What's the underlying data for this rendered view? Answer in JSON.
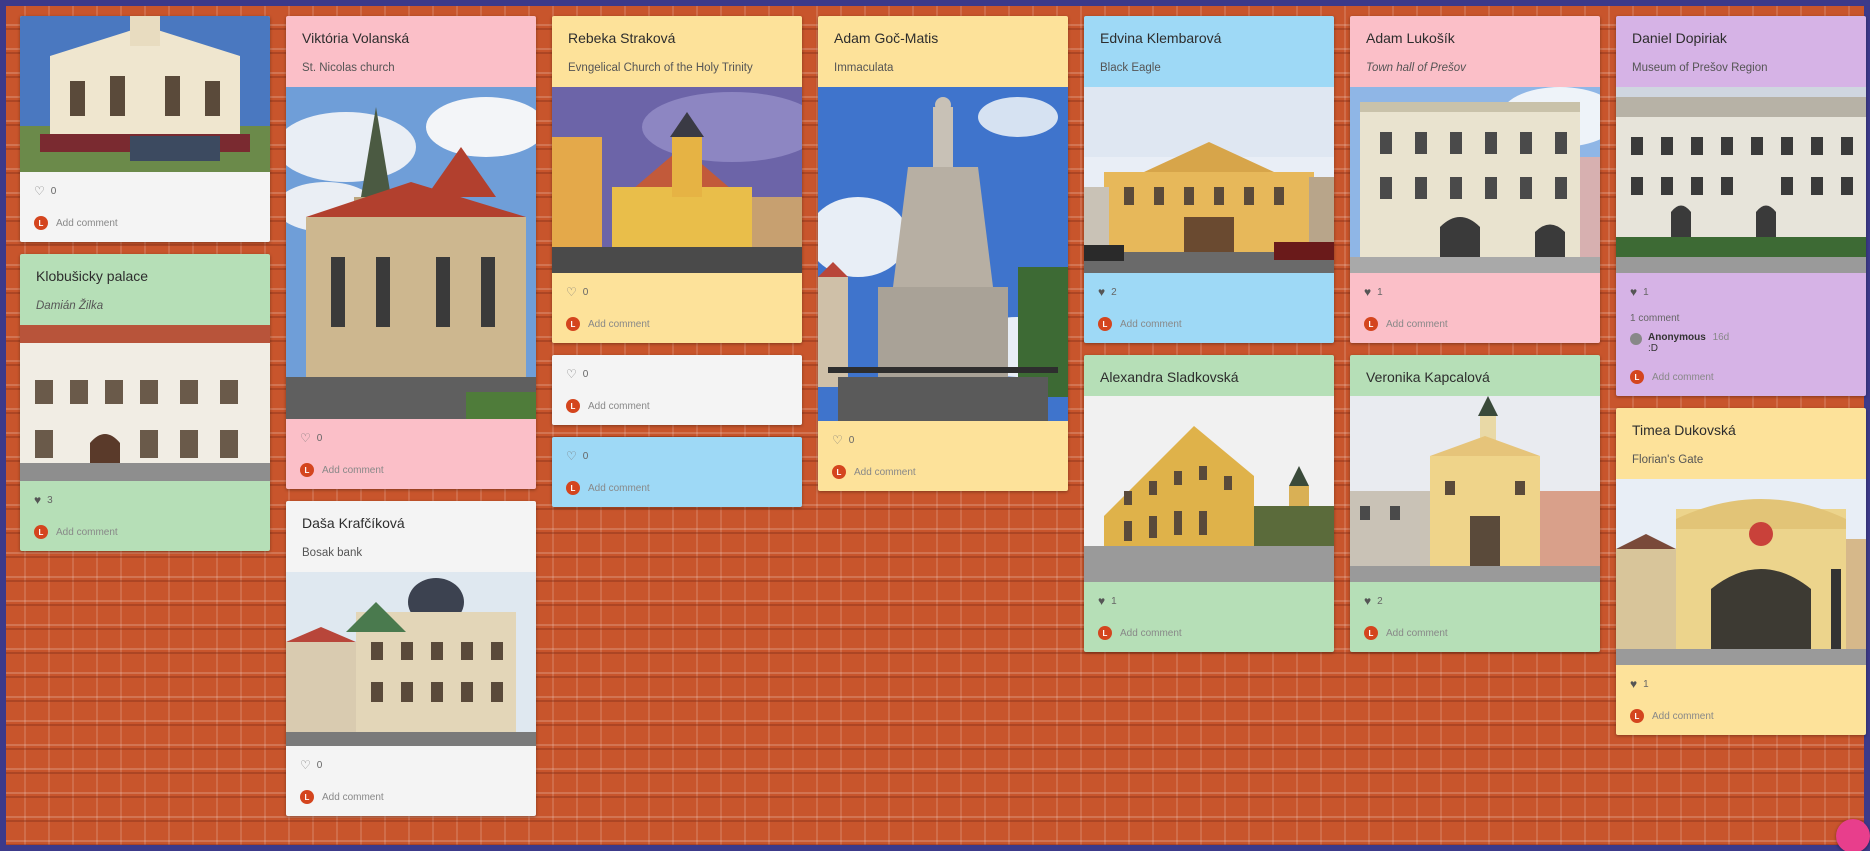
{
  "board": {
    "background": "#c8552c",
    "accent": "#d4451e",
    "add_comment_label": "Add comment",
    "avatar_letter": "L"
  },
  "cards": [
    {
      "id": "c1",
      "author": "",
      "subtitle": "",
      "likes": "0",
      "liked": false,
      "color": "#f4f4f4"
    },
    {
      "id": "c2",
      "author": "Klobušicky palace",
      "subtitle": "Damián Žilka",
      "likes": "3",
      "liked": true,
      "color": "#b6dfb7"
    },
    {
      "id": "c3",
      "author": "Viktória Volanská",
      "subtitle": "St. Nicolas church",
      "likes": "0",
      "liked": false,
      "color": "#fbbfc8"
    },
    {
      "id": "c4",
      "author": "Daša Krafčíková",
      "subtitle": "Bosak bank",
      "likes": "0",
      "liked": false,
      "color": "#f4f4f4"
    },
    {
      "id": "c5",
      "author": "Rebeka Straková",
      "subtitle": "Evngelical Church of the Holy Trinity",
      "likes": "0",
      "liked": false,
      "color": "#fde29a"
    },
    {
      "id": "c6",
      "author": "",
      "subtitle": "",
      "likes": "0",
      "liked": false,
      "color": "#f4f4f4"
    },
    {
      "id": "c7",
      "author": "",
      "subtitle": "",
      "likes": "0",
      "liked": false,
      "color": "#9ed9f6"
    },
    {
      "id": "c8",
      "author": "Adam Goč-Matis",
      "subtitle": "Immaculata",
      "likes": "0",
      "liked": false,
      "color": "#fde29a"
    },
    {
      "id": "c9",
      "author": "Edvina Klembarová",
      "subtitle": "Black Eagle",
      "likes": "2",
      "liked": true,
      "color": "#9ed9f6"
    },
    {
      "id": "c10",
      "author": "Alexandra Sladkovská",
      "subtitle": "",
      "likes": "1",
      "liked": true,
      "color": "#b6dfb7"
    },
    {
      "id": "c11",
      "author": "Adam Lukošík",
      "subtitle": "Town hall of Prešov",
      "likes": "1",
      "liked": true,
      "color": "#fbbfc8"
    },
    {
      "id": "c12",
      "author": "Veronika Kapcalová",
      "subtitle": "",
      "likes": "2",
      "liked": true,
      "color": "#b6dfb7"
    },
    {
      "id": "c13",
      "author": "Daniel Dopiriak",
      "subtitle": "Museum of Prešov Region",
      "likes": "1",
      "liked": true,
      "color": "#d6b3e6",
      "comment_count": "1 comment",
      "comment": {
        "name": "Anonymous",
        "time": "16d",
        "text": ":D"
      }
    },
    {
      "id": "c14",
      "author": "Timea Dukovská",
      "subtitle": "Florian's Gate",
      "likes": "1",
      "liked": true,
      "color": "#fde29a"
    }
  ],
  "icons": {
    "heart_outline": "heart-outline-icon",
    "heart_filled": "heart-filled-icon",
    "avatar": "avatar-icon",
    "fab": "add-post-fab"
  }
}
